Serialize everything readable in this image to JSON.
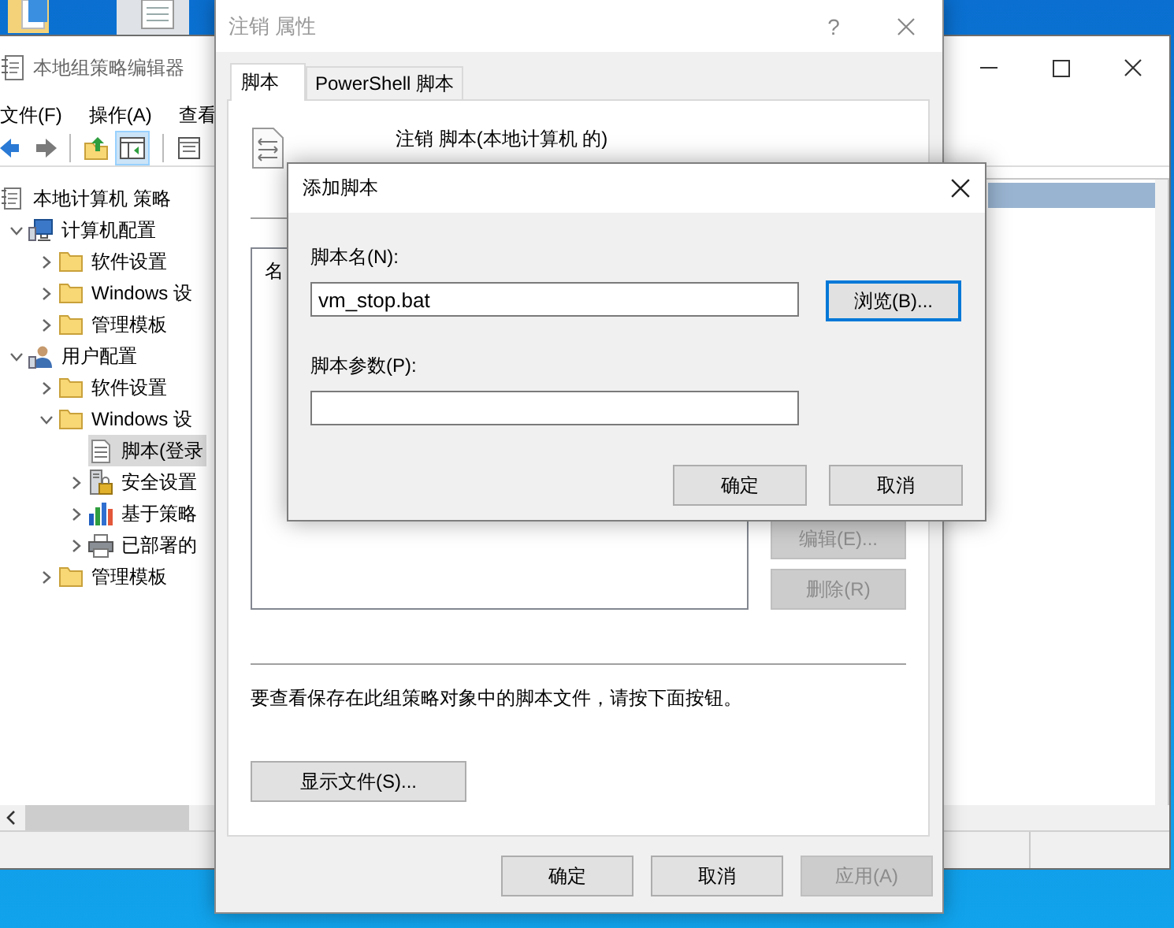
{
  "editor_window": {
    "title": "本地组策略编辑器",
    "menu": [
      "文件(F)",
      "操作(A)",
      "查看"
    ],
    "tree": [
      {
        "label": "本地计算机 策略",
        "kind": "policy",
        "selected": false,
        "children": [
          {
            "label": "计算机配置",
            "kind": "computer",
            "expanded": true,
            "selected": false,
            "children": [
              {
                "label": "软件设置",
                "kind": "folder",
                "expanded": false,
                "selected": false
              },
              {
                "label": "Windows 设",
                "kind": "folder",
                "expanded": false,
                "selected": false
              },
              {
                "label": "管理模板",
                "kind": "folder",
                "expanded": false,
                "selected": false
              }
            ]
          },
          {
            "label": "用户配置",
            "kind": "user",
            "expanded": true,
            "selected": false,
            "children": [
              {
                "label": "软件设置",
                "kind": "folder",
                "expanded": false,
                "selected": false
              },
              {
                "label": "Windows 设",
                "kind": "folder",
                "expanded": true,
                "selected": false,
                "children": [
                  {
                    "label": "脚本(登录",
                    "kind": "script",
                    "selected": true
                  },
                  {
                    "label": "安全设置",
                    "kind": "security",
                    "expanded": false,
                    "selected": false
                  },
                  {
                    "label": "基于策略",
                    "kind": "chart",
                    "expanded": false,
                    "selected": false
                  },
                  {
                    "label": "已部署的",
                    "kind": "printer",
                    "expanded": false,
                    "selected": false
                  }
                ]
              },
              {
                "label": "管理模板",
                "kind": "folder",
                "expanded": false,
                "selected": false
              }
            ]
          }
        ]
      }
    ]
  },
  "properties_window": {
    "title": "注销 属性",
    "help_button": "?",
    "tabs": [
      {
        "label": "脚本",
        "selected": true
      },
      {
        "label": "PowerShell 脚本",
        "selected": false
      }
    ],
    "heading": "注销 脚本(本地计算机 的)",
    "list_column": "名",
    "side_buttons": [
      {
        "label": "编辑(E)...",
        "disabled": true
      },
      {
        "label": "删除(R)",
        "disabled": true
      }
    ],
    "hint": "要查看保存在此组策略对象中的脚本文件，请按下面按钮。",
    "show_files_button": "显示文件(S)...",
    "buttons": [
      {
        "label": "确定",
        "disabled": false
      },
      {
        "label": "取消",
        "disabled": false
      },
      {
        "label": "应用(A)",
        "disabled": true
      }
    ]
  },
  "add_script_dialog": {
    "title": "添加脚本",
    "name_label": "脚本名(N):",
    "name_value": "vm_stop.bat",
    "browse_button": {
      "label": "浏览(B)...",
      "focused": true
    },
    "params_label": "脚本参数(P):",
    "buttons": [
      {
        "label": "确定",
        "focused": false
      },
      {
        "label": "取消",
        "focused": false
      }
    ]
  }
}
